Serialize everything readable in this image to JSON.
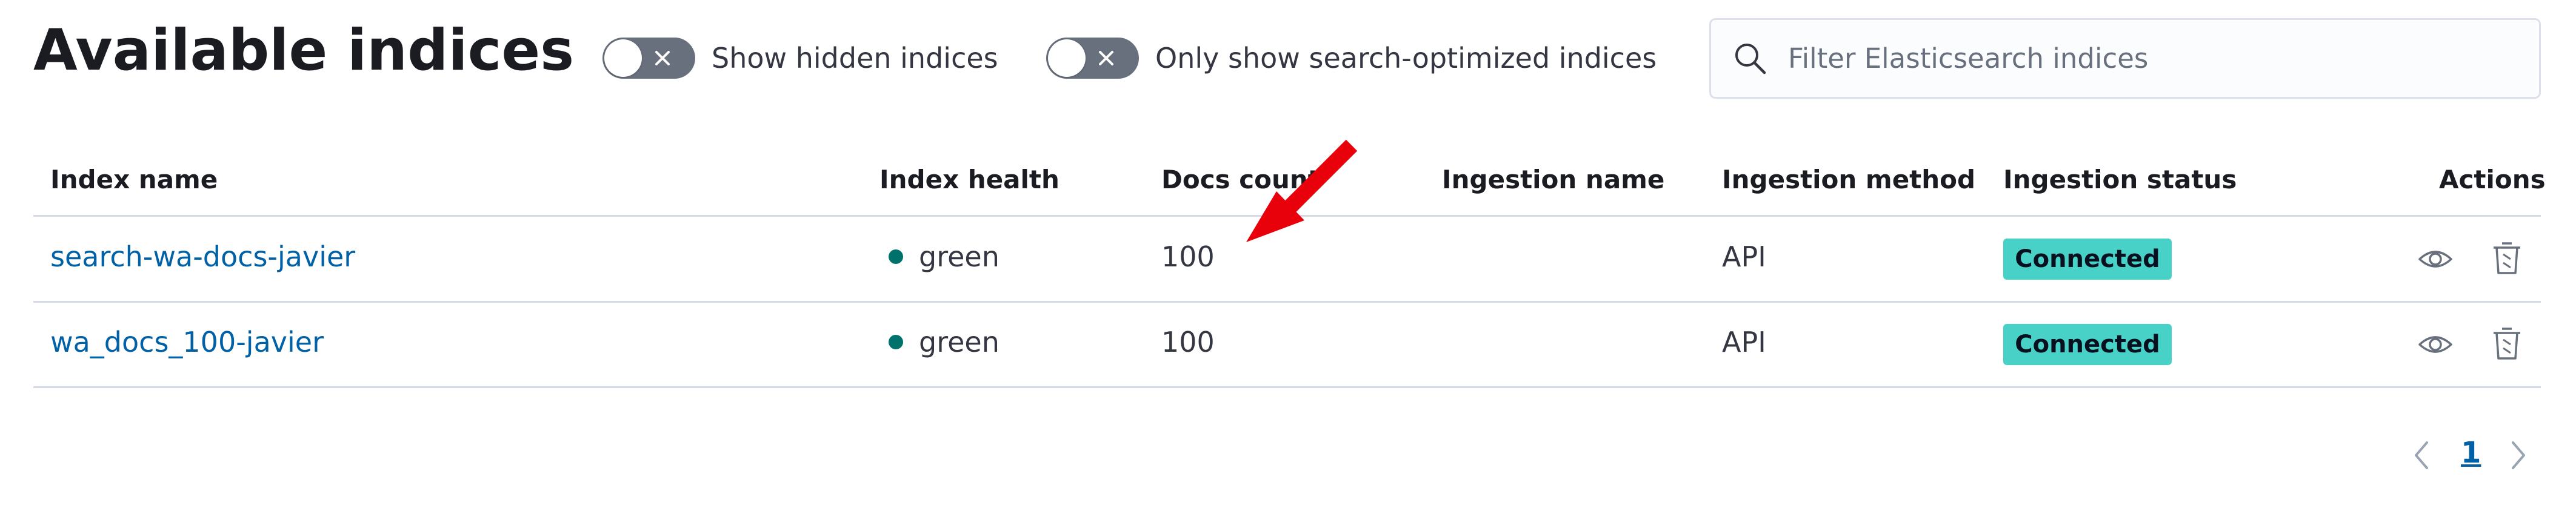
{
  "header": {
    "title": "Available indices",
    "toggles": [
      {
        "label": "Show hidden indices",
        "checked": false
      },
      {
        "label": "Only show search-optimized indices",
        "checked": false
      }
    ],
    "search": {
      "placeholder": "Filter Elasticsearch indices",
      "value": ""
    }
  },
  "table": {
    "columns": [
      "Index name",
      "Index health",
      "Docs count",
      "Ingestion name",
      "Ingestion method",
      "Ingestion status",
      "Actions"
    ],
    "rows": [
      {
        "index_name": "search-wa-docs-javier",
        "health": "green",
        "docs_count": "100",
        "ingestion_name": "",
        "ingestion_method": "API",
        "ingestion_status": "Connected"
      },
      {
        "index_name": "wa_docs_100-javier",
        "health": "green",
        "docs_count": "100",
        "ingestion_name": "",
        "ingestion_method": "API",
        "ingestion_status": "Connected"
      }
    ],
    "actions": [
      "eye-icon",
      "trash-icon"
    ]
  },
  "pagination": {
    "current_page": "1"
  },
  "annotation": {
    "type": "arrow",
    "color": "#e8000b",
    "points_to": "docs-count of first row"
  },
  "colors": {
    "link": "#0061a6",
    "health_green": "#00726b",
    "badge_connected": "#48d1c6",
    "switch_off": "#69707d",
    "border": "#d3dae6"
  }
}
